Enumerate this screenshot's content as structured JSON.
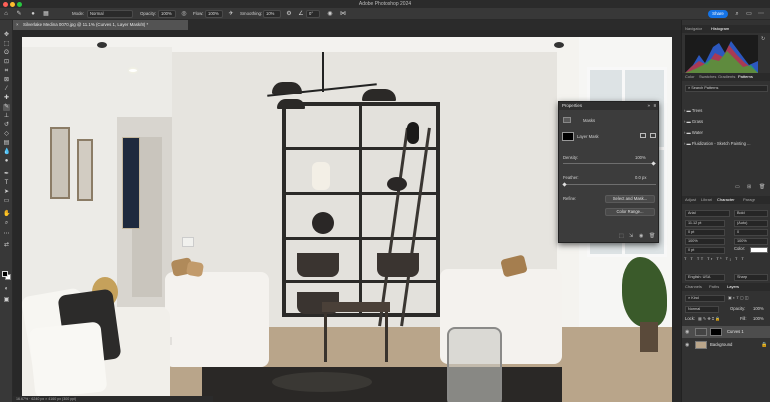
{
  "window": {
    "title": "Adobe Photoshop 2024"
  },
  "options_bar": {
    "mode_label": "Mode:",
    "mode_value": "Normal",
    "opacity_label": "Opacity:",
    "opacity_value": "100%",
    "flow_label": "Flow:",
    "flow_value": "100%",
    "smoothing_label": "Smoothing:",
    "smoothing_value": "10%",
    "angle_value": "0°",
    "share_label": "Share"
  },
  "document": {
    "tab_title": "Silverlake Medina 0070.jpg @ 11.1% (Curves 1, Layer Mask/8) *",
    "status": "16.67% · 6240 px × 4160 px (300 ppi)"
  },
  "properties": {
    "title": "Properties",
    "masks_label": "Masks",
    "layer_mask_label": "Layer Mask",
    "density_label": "Density:",
    "density_value": "100%",
    "feather_label": "Feather:",
    "feather_value": "0.0 px",
    "refine_label": "Refine:",
    "select_and_mask_label": "Select and Mask...",
    "color_range_label": "Color Range..."
  },
  "right_panels": {
    "top_tabs": [
      "Navigator",
      "Histogram"
    ],
    "mid_tabs": [
      "Color",
      "Swatches",
      "Gradients",
      "Patterns"
    ],
    "search_placeholder": "Search Patterns",
    "pattern_groups": [
      "Trees",
      "Grass",
      "Water",
      "Fluidization - Sketch Painting ..."
    ],
    "char_tabs": [
      "Adjust",
      "Librari",
      "Character",
      "Paragr"
    ],
    "font_family": "Arial",
    "font_style": "Bold",
    "font_size": "11.12 pt",
    "leading": "(Auto)",
    "kerning": "0 pt",
    "tracking": "0",
    "vscale": "100%",
    "hscale": "100%",
    "baseline": "0 pt",
    "color_label": "Color:",
    "language": "English: USA",
    "antialias": "Sharp",
    "layers_tabs": [
      "Channels",
      "Paths",
      "Layers"
    ],
    "layer_filter": "Kind",
    "blend_mode": "Normal",
    "opacity_label": "Opacity:",
    "opacity_value": "100%",
    "lock_label": "Lock:",
    "fill_label": "Fill:",
    "fill_value": "100%",
    "layers": [
      {
        "name": "Curves 1",
        "selected": true
      },
      {
        "name": "Background",
        "selected": false
      }
    ]
  },
  "colors": {
    "accent": "#1473e6",
    "panel_bg": "#323232",
    "toolbar_bg": "#383838"
  },
  "icons": {
    "toolbar": [
      "move-icon",
      "marquee-icon",
      "lasso-icon",
      "object-select-icon",
      "crop-icon",
      "frame-icon",
      "eyedropper-icon",
      "healing-icon",
      "brush-icon",
      "clone-stamp-icon",
      "history-brush-icon",
      "eraser-icon",
      "gradient-icon",
      "blur-icon",
      "dodge-icon",
      "pen-icon",
      "type-icon",
      "path-select-icon",
      "rectangle-icon",
      "hand-icon",
      "zoom-icon",
      "more-tools-icon"
    ]
  }
}
